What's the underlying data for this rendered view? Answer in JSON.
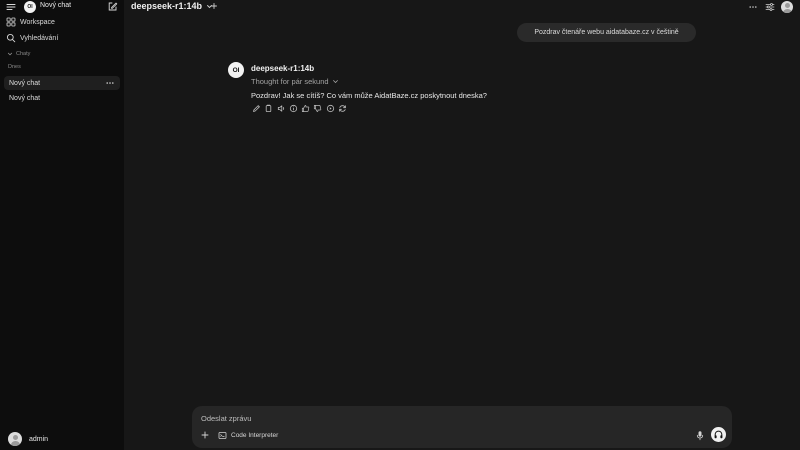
{
  "sidebar": {
    "logo_text": "OI",
    "title": "Nový chat",
    "workspace_label": "Workspace",
    "search_label": "Vyhledávání",
    "section_label": "Chaty",
    "group_label": "Dnes",
    "chats": [
      {
        "label": "Nový chat",
        "active": true
      },
      {
        "label": "Nový chat",
        "active": false
      }
    ],
    "user_name": "admin"
  },
  "header": {
    "model_name": "deepseek-r1:14b"
  },
  "chat": {
    "user_message": "Pozdrav čtenáře webu aidatabaze.cz v češtině",
    "bot_logo": "OI",
    "bot_name": "deepseek-r1:14b",
    "thought_label": "Thought for pár sekund",
    "bot_message": "Pozdrav! Jak se cítíš? Co vám může AidatBaze.cz poskytnout dneska?",
    "action_icons": [
      "edit-icon",
      "copy-icon",
      "speaker-icon",
      "info-icon",
      "thumbs-up-icon",
      "thumbs-down-icon",
      "continue-icon",
      "regenerate-icon"
    ]
  },
  "composer": {
    "placeholder": "Odeslat zprávu",
    "code_interpreter_label": "Code Interpreter"
  },
  "colors": {
    "sidebar_bg": "#0d0d0d",
    "main_bg": "#171717",
    "bubble_bg": "#2a2a2a",
    "composer_bg": "#262626"
  }
}
